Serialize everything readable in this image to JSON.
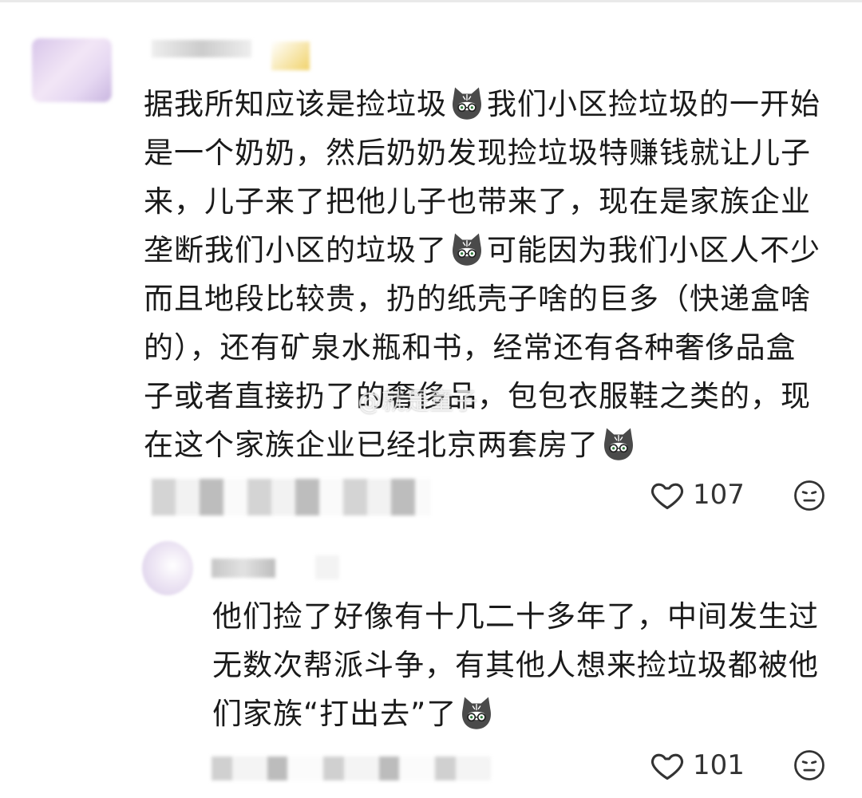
{
  "comments": [
    {
      "lines": [
        [
          "据我所知应该是捡垃圾",
          "[cat]",
          "我们小区捡垃圾的一开始"
        ],
        [
          "是一个奶奶，然后奶奶发现捡垃圾特赚钱就让儿子"
        ],
        [
          "来，儿子来了把他儿子也带来了，现在是家族企业"
        ],
        [
          "垄断我们小区的垃圾了",
          "[cat]",
          "可能因为我们小区人不少"
        ],
        [
          "而且地段比较贵，扔的纸壳子啥的巨多（快递盒啥"
        ],
        [
          "的），还有矿泉水瓶和书，经常还有各种奢侈品盒"
        ],
        [
          "子或者直接扔了的奢侈品，包包衣服鞋之类的，现"
        ],
        [
          "在这个家族企业已经北京两套房了",
          "[cat]"
        ]
      ],
      "like_count": "107"
    },
    {
      "lines": [
        [
          "他们捡了好像有十几二十多年了，中间发生过"
        ],
        [
          "无数次帮派斗争，有其他人想来捡垃圾都被他"
        ],
        [
          "们家族“打出去”了",
          "[cat]"
        ]
      ],
      "like_count": "101"
    }
  ],
  "watermark": "@就是童子",
  "colors": {
    "text": "#1a1a1a",
    "icon": "#333333",
    "blur_gray": "#c8c8c8"
  }
}
